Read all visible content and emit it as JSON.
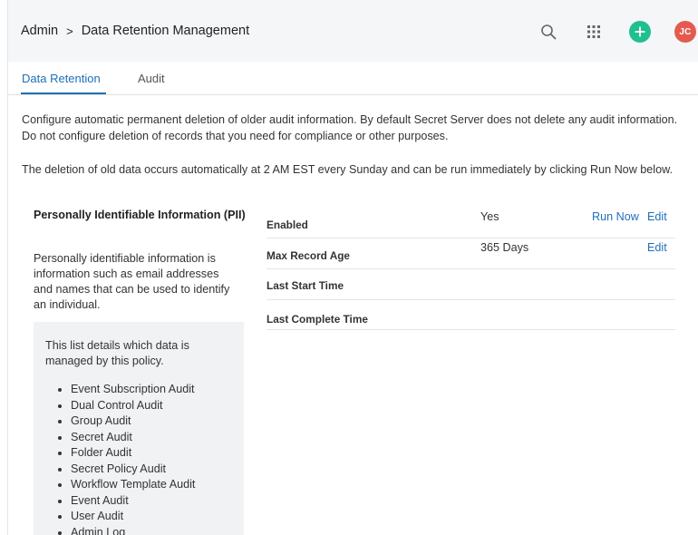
{
  "header": {
    "breadcrumb_root": "Admin",
    "breadcrumb_separator": ">",
    "breadcrumb_current": "Data Retention Management",
    "icons": [
      "search-icon",
      "apps-grid-icon",
      "add-circle-icon"
    ],
    "avatar_initials": "JC",
    "colors": {
      "add_button": "#1fbf8f",
      "avatar": "#e55a4f",
      "accent": "#1f6fb8"
    }
  },
  "tabs": [
    {
      "label": "Data Retention",
      "active": true
    },
    {
      "label": "Audit",
      "active": false
    }
  ],
  "intro": "Configure automatic permanent deletion of older audit information. By default Secret Server does not delete any audit information. Do not configure deletion of records that you need for compliance or other purposes.",
  "schedule": "The deletion of old data occurs automatically at 2 AM EST every Sunday and can be run immediately by clicking Run Now below.",
  "pii": {
    "title": "Personally Identifiable Information (PII)",
    "description": "Personally identifiable information is information such as email addresses and names that can be used to identify an individual.",
    "policy_intro": "This list details which data is managed by this policy.",
    "items": [
      "Event Subscription Audit",
      "Dual Control Audit",
      "Group Audit",
      "Secret Audit",
      "Folder Audit",
      "Secret Policy Audit",
      "Workflow Template Audit",
      "Event Audit",
      "User Audit",
      "Admin Log"
    ]
  },
  "settings": {
    "enabled": {
      "label": "Enabled",
      "value": "Yes",
      "run_now": "Run Now",
      "edit": "Edit"
    },
    "max_record_age": {
      "label": "Max Record Age",
      "value": "365 Days",
      "edit": "Edit"
    },
    "last_start_time": {
      "label": "Last Start Time",
      "value": ""
    },
    "last_complete_time": {
      "label": "Last Complete Time",
      "value": ""
    }
  }
}
